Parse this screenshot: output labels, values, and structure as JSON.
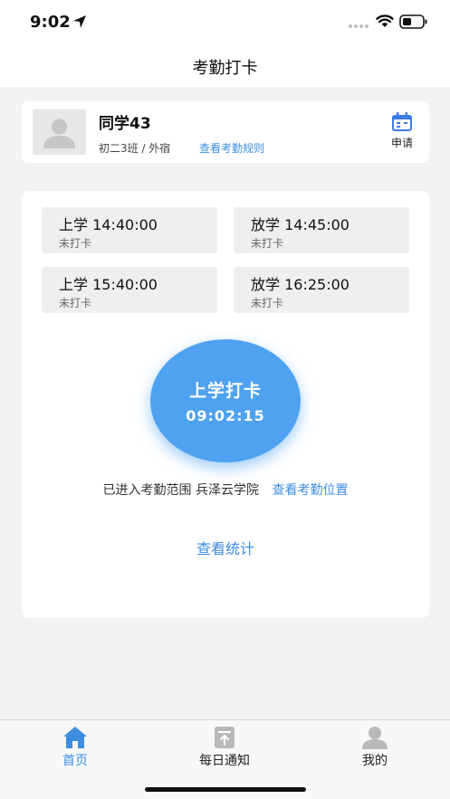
{
  "status_bar": {
    "time": "9:02"
  },
  "header": {
    "title": "考勤打卡"
  },
  "profile": {
    "name": "同学43",
    "class_info": "初二3班 / 外宿",
    "rules_link": "查看考勤规则",
    "apply_label": "申请",
    "avatar_icon": "user-avatar-placeholder"
  },
  "schedule": [
    {
      "time": "上学 14:40:00",
      "status": "未打卡"
    },
    {
      "time": "放学 14:45:00",
      "status": "未打卡"
    },
    {
      "time": "上学 15:40:00",
      "status": "未打卡"
    },
    {
      "time": "放学 16:25:00",
      "status": "未打卡"
    }
  ],
  "checkin": {
    "label": "上学打卡",
    "clock": "09:02:15",
    "range_text": "已进入考勤范围 兵泽云学院",
    "location_link": "查看考勤位置",
    "stats_link": "查看统计"
  },
  "tabs": [
    {
      "label": "首页",
      "icon": "home-icon",
      "active": true
    },
    {
      "label": "每日通知",
      "icon": "notice-icon",
      "active": false
    },
    {
      "label": "我的",
      "icon": "profile-icon",
      "active": false
    }
  ],
  "colors": {
    "accent": "#3d8de0",
    "checkin_button": "#4ea2f0",
    "page_bg": "#f3f3f3",
    "slot_bg": "#efefef"
  }
}
